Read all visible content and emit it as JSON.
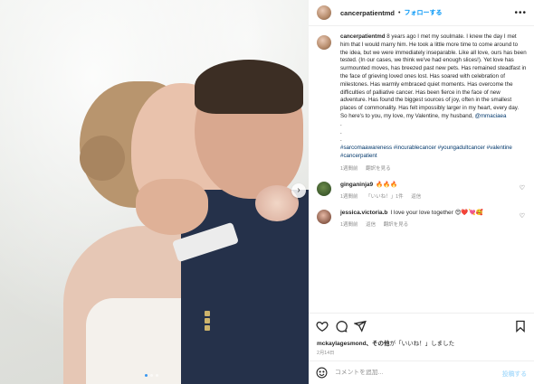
{
  "post": {
    "username": "cancerpatientmd",
    "separator": "•",
    "follow_label": "フォローする",
    "more_label": "•••"
  },
  "caption": {
    "username": "cancerpatientmd",
    "text": "8 years ago I met my soulmate. I knew the day I met him that I would marry him. He took a little more time to come around to the idea, but we were immediately inseparable. Like all love, ours has been tested. (In our cases, we think we've had enough slices!). Yet love has surmounted moves, has breezed past new pets. Has remained steadfast in the face of grieving loved ones lost. Has soared with celebration of milestones. Has warmly embraced quiet moments. Has overcome the difficulties of palliative cancer. Has been fierce in the face of new adventure. Has found the biggest sources of joy, often in the smallest places of commonality. Has felt impossibly larger in my heart, every day. So here's to you, my love, my Valentine, my husband, ",
    "mention": "@mmaciaea",
    "dots": ".\n.\n.",
    "hashtags": "#sarcomaawareness #incurablecancer #youngadultcancer #valentine #cancerpatient",
    "time": "1週間前",
    "translate": "翻訳を見る"
  },
  "comments": [
    {
      "username": "ginganinja9",
      "text": "🔥🔥🔥",
      "time": "1週間前",
      "likes": "「いいね！」1件",
      "reply": "返信"
    },
    {
      "username": "jessica.victoria.b",
      "text": "I love your love together 😍❤️💘🥰",
      "time": "1週間前",
      "reply": "返信",
      "translate": "翻訳を見る"
    }
  ],
  "likes_line": {
    "user": "mckaylagesmond、その他",
    "suffix": "が「いいね！」しました"
  },
  "date": "2月14日",
  "comment_input": {
    "placeholder": "コメントを追加...",
    "post_label": "投稿する"
  },
  "carousel": {
    "next_label": "›",
    "slide_count": 3,
    "active_slide": 1
  },
  "colors": {
    "accent": "#0095f6",
    "post_disabled": "#b2dffc",
    "link": "#00376b",
    "muted": "#8e8e8e"
  }
}
